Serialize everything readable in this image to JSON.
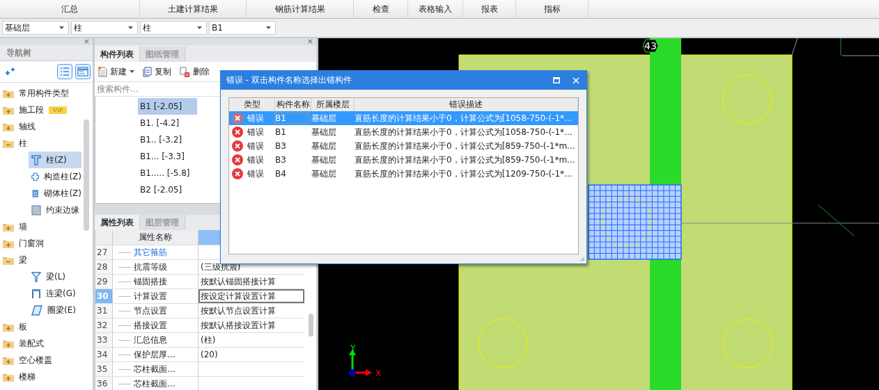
{
  "menu_tabs": [
    "汇总",
    "土建计算结果",
    "钢筋计算结果",
    "检查",
    "表格输入",
    "报表",
    "指标"
  ],
  "selectors": [
    "基础层",
    "柱",
    "柱",
    "B1"
  ],
  "nav_panel": {
    "close": "×",
    "title": "导航树",
    "tree": [
      {
        "label": "常用构件类型",
        "expanded": false
      },
      {
        "label": "施工段",
        "badge": "VIP",
        "expanded": false
      },
      {
        "label": "轴线",
        "expanded": false
      },
      {
        "label": "柱",
        "expanded": true,
        "children": [
          {
            "label": "柱(Z)",
            "kind": "column",
            "selected": true
          },
          {
            "label": "构造柱(Z)",
            "kind": "constructional-column",
            "selected": false
          },
          {
            "label": "砌体柱(Z)",
            "kind": "masonry-column",
            "selected": false
          },
          {
            "label": "约束边缘",
            "kind": "edge-member",
            "selected": false
          }
        ]
      },
      {
        "label": "墙",
        "expanded": false
      },
      {
        "label": "门窗洞",
        "expanded": false
      },
      {
        "label": "梁",
        "expanded": true,
        "children": [
          {
            "label": "梁(L)",
            "kind": "beam",
            "selected": false
          },
          {
            "label": "连梁(G)",
            "kind": "coupling-beam",
            "selected": false
          },
          {
            "label": "圈梁(E)",
            "kind": "ring-beam",
            "selected": false
          }
        ]
      },
      {
        "label": "板",
        "expanded": false
      },
      {
        "label": "装配式",
        "expanded": false
      },
      {
        "label": "空心楼盖",
        "expanded": false
      },
      {
        "label": "楼梯",
        "expanded": false
      }
    ]
  },
  "component_panel": {
    "close": "×",
    "tabs": [
      {
        "label": "构件列表",
        "selected": true
      },
      {
        "label": "图纸管理",
        "selected": false
      }
    ],
    "toolbar": [
      {
        "label": "新建",
        "kind": "new"
      },
      {
        "label": "复制",
        "kind": "copy"
      },
      {
        "label": "删除",
        "kind": "delete"
      }
    ],
    "search": {
      "placeholder": "搜索构件..."
    },
    "items": [
      {
        "label": "B1 [-2.05]",
        "selected": true
      },
      {
        "label": "B1. [-4.2]",
        "selected": false
      },
      {
        "label": "B1.. [-3.2]",
        "selected": false
      },
      {
        "label": "B1... [-3.3]",
        "selected": false
      },
      {
        "label": "B1..... [-5.8]",
        "selected": false
      },
      {
        "label": "B2 [-2.05]",
        "selected": false
      }
    ]
  },
  "property_panel": {
    "tabs": [
      {
        "label": "属性列表",
        "selected": true
      },
      {
        "label": "图层管理",
        "selected": false
      }
    ],
    "columns": [
      "属性名称"
    ],
    "rows": [
      {
        "number": "27",
        "name": "其它箍筋",
        "kind": "group",
        "selected": false
      },
      {
        "number": "28",
        "name": "抗震等级",
        "value": "(三级抗震)",
        "kind": "item",
        "selected": false
      },
      {
        "number": "29",
        "name": "锚固搭接",
        "value": "按默认锚固搭接计算",
        "kind": "item",
        "selected": false
      },
      {
        "number": "30",
        "name": "计算设置",
        "value": "按设定计算设置计算",
        "kind": "item",
        "selected": true
      },
      {
        "number": "31",
        "name": "节点设置",
        "value": "按默认节点设置计算",
        "kind": "item",
        "selected": false
      },
      {
        "number": "32",
        "name": "搭接设置",
        "value": "按默认搭接设置计算",
        "kind": "item",
        "selected": false
      },
      {
        "number": "33",
        "name": "汇总信息",
        "value": "(柱)",
        "kind": "item",
        "selected": false
      },
      {
        "number": "34",
        "name": "保护层厚...",
        "value": "(20)",
        "kind": "item",
        "selected": false
      },
      {
        "number": "35",
        "name": "芯柱截面...",
        "kind": "item",
        "selected": false
      },
      {
        "number": "36",
        "name": "芯柱截面...",
        "kind": "item",
        "selected": false
      }
    ]
  },
  "canvas": {
    "axis_number": "43",
    "x_label": "X",
    "y_label": "Y"
  },
  "error_dialog": {
    "title": "错误 - 双击构件名称选择出错构件",
    "columns": [
      "类型",
      "构件名称",
      "所属楼层",
      "错误描述"
    ],
    "rows": [
      {
        "type": "错误",
        "name": "B1",
        "floor": "基础层",
        "description": "直筋长度的计算结果小于0，计算公式为[1058-750-(-1*...",
        "selected": true
      },
      {
        "type": "错误",
        "name": "B1",
        "floor": "基础层",
        "description": "直筋长度的计算结果小于0，计算公式为[1058-750-(-1*...",
        "selected": false
      },
      {
        "type": "错误",
        "name": "B3",
        "floor": "基础层",
        "description": "直筋长度的计算结果小于0，计算公式为[859-750-(-1*m...",
        "selected": false
      },
      {
        "type": "错误",
        "name": "B3",
        "floor": "基础层",
        "description": "直筋长度的计算结果小于0，计算公式为[859-750-(-1*m...",
        "selected": false
      },
      {
        "type": "错误",
        "name": "B4",
        "floor": "基础层",
        "description": "直筋长度的计算结果小于0，计算公式为[1209-750-(-1*...",
        "selected": false
      }
    ]
  }
}
